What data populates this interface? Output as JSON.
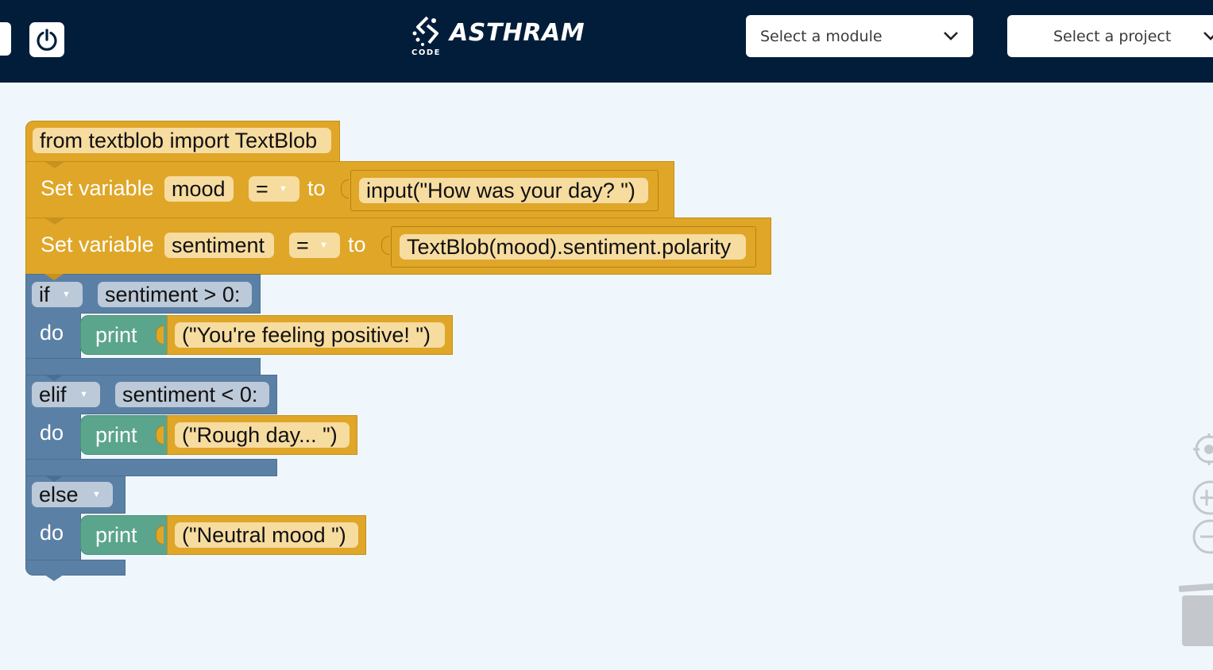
{
  "header": {
    "logo": {
      "name": "ASTHRAM",
      "sub": "CODE"
    },
    "module_select": {
      "label": "Select a module"
    },
    "project_select": {
      "label": "Select a project"
    }
  },
  "workspace": {
    "import_block": {
      "text": "from textblob import TextBlob"
    },
    "set_mood": {
      "label": "Set variable",
      "var": "mood",
      "op": "=",
      "to": "to",
      "value": "input(\"How was your day? \")"
    },
    "set_sentiment": {
      "label": "Set variable",
      "var": "sentiment",
      "op": "=",
      "to": "to",
      "value": "TextBlob(mood).sentiment.polarity"
    },
    "if_block": {
      "keyword": "if",
      "condition": "sentiment > 0:",
      "do": "do",
      "print": {
        "label": "print",
        "arg": "(\"You're feeling positive! \")"
      }
    },
    "elif_block": {
      "keyword": "elif",
      "condition": "sentiment < 0:",
      "do": "do",
      "print": {
        "label": "print",
        "arg": "(\"Rough day... \")"
      }
    },
    "else_block": {
      "keyword": "else",
      "do": "do",
      "print": {
        "label": "print",
        "arg": "(\"Neutral mood \")"
      }
    }
  },
  "tools": {
    "recenter": "crosshair-icon",
    "zoom_in": "zoom-in-icon",
    "zoom_out": "zoom-out-icon",
    "trash": "trash-icon"
  },
  "colors": {
    "header": "#021d39",
    "workspace": "#f0f7fc",
    "variable_block": "#dfa628",
    "logic_block": "#5b80a5",
    "print_block": "#5ba58c"
  }
}
